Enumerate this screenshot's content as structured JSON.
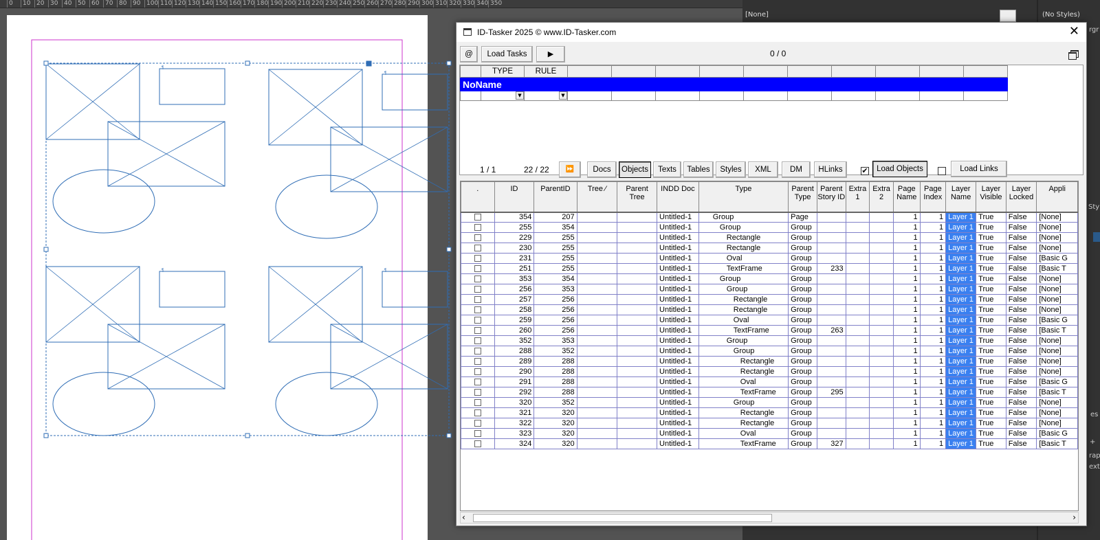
{
  "ruler": {
    "numbers": [
      "0",
      "10",
      "20",
      "30",
      "40",
      "50",
      "60",
      "70",
      "80",
      "90",
      "100",
      "110",
      "120",
      "130",
      "140",
      "150",
      "160",
      "170",
      "180",
      "190",
      "200",
      "210",
      "220",
      "230",
      "240",
      "250",
      "260",
      "270",
      "280",
      "290",
      "300",
      "310",
      "320",
      "330",
      "340",
      "350"
    ]
  },
  "right_panel": {
    "swatch_label": "[None]",
    "styles_label": "(No Styles)",
    "cut_labels": [
      "rgr",
      "Styl",
      "es",
      "+",
      "raph",
      "ext F"
    ]
  },
  "window": {
    "title": "ID-Tasker 2025  © www.ID-Tasker.com",
    "close_glyph": "✕",
    "toolbar": {
      "at_label": "@",
      "load_tasks_label": "Load Tasks",
      "play_glyph": "▶",
      "counter": "0 / 0"
    },
    "task_grid": {
      "headers": [
        "",
        "TYPE",
        "RULE",
        "",
        "",
        "",
        "",
        "",
        "",
        "",
        "",
        "",
        ""
      ],
      "group_name": "NoName"
    },
    "nav": {
      "pages": "1 / 1",
      "count": "22 / 22",
      "ffwd_glyph": "⏩",
      "tabs": [
        "Docs",
        "Objects",
        "Texts",
        "Tables",
        "Styles",
        "XML",
        "DM",
        "HLinks"
      ],
      "selected_tab": "Objects",
      "load_objects_checked": "✔",
      "load_objects_label": "Load Objects",
      "load_links_checked": "",
      "load_links_label": "Load Links"
    },
    "grid": {
      "columns": [
        ".",
        "ID",
        "ParentID",
        "Tree  ⁄",
        "Parent Tree",
        "INDD Doc",
        "Type",
        "Parent Type",
        "Parent Story ID",
        "Extra 1",
        "Extra 2",
        "Page Name",
        "Page Index",
        "Layer Name",
        "Layer Visible",
        "Layer Locked",
        "Appli"
      ],
      "rows": [
        {
          "id": "354",
          "parent": "207",
          "doc": "Untitled-1",
          "type": "Group",
          "indent": 2,
          "ptype": "Page",
          "story": "",
          "page": "1",
          "index": "1",
          "layer": "Layer 1",
          "vis": "True",
          "lock": "False",
          "appl": "[None]"
        },
        {
          "id": "255",
          "parent": "354",
          "doc": "Untitled-1",
          "type": "Group",
          "indent": 3,
          "ptype": "Group",
          "story": "",
          "page": "1",
          "index": "1",
          "layer": "Layer 1",
          "vis": "True",
          "lock": "False",
          "appl": "[None]"
        },
        {
          "id": "229",
          "parent": "255",
          "doc": "Untitled-1",
          "type": "Rectangle",
          "indent": 4,
          "ptype": "Group",
          "story": "",
          "page": "1",
          "index": "1",
          "layer": "Layer 1",
          "vis": "True",
          "lock": "False",
          "appl": "[None]"
        },
        {
          "id": "230",
          "parent": "255",
          "doc": "Untitled-1",
          "type": "Rectangle",
          "indent": 4,
          "ptype": "Group",
          "story": "",
          "page": "1",
          "index": "1",
          "layer": "Layer 1",
          "vis": "True",
          "lock": "False",
          "appl": "[None]"
        },
        {
          "id": "231",
          "parent": "255",
          "doc": "Untitled-1",
          "type": "Oval",
          "indent": 4,
          "ptype": "Group",
          "story": "",
          "page": "1",
          "index": "1",
          "layer": "Layer 1",
          "vis": "True",
          "lock": "False",
          "appl": "[Basic G"
        },
        {
          "id": "251",
          "parent": "255",
          "doc": "Untitled-1",
          "type": "TextFrame",
          "indent": 4,
          "ptype": "Group",
          "story": "233",
          "page": "1",
          "index": "1",
          "layer": "Layer 1",
          "vis": "True",
          "lock": "False",
          "appl": "[Basic T"
        },
        {
          "id": "353",
          "parent": "354",
          "doc": "Untitled-1",
          "type": "Group",
          "indent": 3,
          "ptype": "Group",
          "story": "",
          "page": "1",
          "index": "1",
          "layer": "Layer 1",
          "vis": "True",
          "lock": "False",
          "appl": "[None]"
        },
        {
          "id": "256",
          "parent": "353",
          "doc": "Untitled-1",
          "type": "Group",
          "indent": 4,
          "ptype": "Group",
          "story": "",
          "page": "1",
          "index": "1",
          "layer": "Layer 1",
          "vis": "True",
          "lock": "False",
          "appl": "[None]"
        },
        {
          "id": "257",
          "parent": "256",
          "doc": "Untitled-1",
          "type": "Rectangle",
          "indent": 5,
          "ptype": "Group",
          "story": "",
          "page": "1",
          "index": "1",
          "layer": "Layer 1",
          "vis": "True",
          "lock": "False",
          "appl": "[None]"
        },
        {
          "id": "258",
          "parent": "256",
          "doc": "Untitled-1",
          "type": "Rectangle",
          "indent": 5,
          "ptype": "Group",
          "story": "",
          "page": "1",
          "index": "1",
          "layer": "Layer 1",
          "vis": "True",
          "lock": "False",
          "appl": "[None]"
        },
        {
          "id": "259",
          "parent": "256",
          "doc": "Untitled-1",
          "type": "Oval",
          "indent": 5,
          "ptype": "Group",
          "story": "",
          "page": "1",
          "index": "1",
          "layer": "Layer 1",
          "vis": "True",
          "lock": "False",
          "appl": "[Basic G"
        },
        {
          "id": "260",
          "parent": "256",
          "doc": "Untitled-1",
          "type": "TextFrame",
          "indent": 5,
          "ptype": "Group",
          "story": "263",
          "page": "1",
          "index": "1",
          "layer": "Layer 1",
          "vis": "True",
          "lock": "False",
          "appl": "[Basic T"
        },
        {
          "id": "352",
          "parent": "353",
          "doc": "Untitled-1",
          "type": "Group",
          "indent": 4,
          "ptype": "Group",
          "story": "",
          "page": "1",
          "index": "1",
          "layer": "Layer 1",
          "vis": "True",
          "lock": "False",
          "appl": "[None]"
        },
        {
          "id": "288",
          "parent": "352",
          "doc": "Untitled-1",
          "type": "Group",
          "indent": 5,
          "ptype": "Group",
          "story": "",
          "page": "1",
          "index": "1",
          "layer": "Layer 1",
          "vis": "True",
          "lock": "False",
          "appl": "[None]"
        },
        {
          "id": "289",
          "parent": "288",
          "doc": "Untitled-1",
          "type": "Rectangle",
          "indent": 6,
          "ptype": "Group",
          "story": "",
          "page": "1",
          "index": "1",
          "layer": "Layer 1",
          "vis": "True",
          "lock": "False",
          "appl": "[None]"
        },
        {
          "id": "290",
          "parent": "288",
          "doc": "Untitled-1",
          "type": "Rectangle",
          "indent": 6,
          "ptype": "Group",
          "story": "",
          "page": "1",
          "index": "1",
          "layer": "Layer 1",
          "vis": "True",
          "lock": "False",
          "appl": "[None]"
        },
        {
          "id": "291",
          "parent": "288",
          "doc": "Untitled-1",
          "type": "Oval",
          "indent": 6,
          "ptype": "Group",
          "story": "",
          "page": "1",
          "index": "1",
          "layer": "Layer 1",
          "vis": "True",
          "lock": "False",
          "appl": "[Basic G"
        },
        {
          "id": "292",
          "parent": "288",
          "doc": "Untitled-1",
          "type": "TextFrame",
          "indent": 6,
          "ptype": "Group",
          "story": "295",
          "page": "1",
          "index": "1",
          "layer": "Layer 1",
          "vis": "True",
          "lock": "False",
          "appl": "[Basic T"
        },
        {
          "id": "320",
          "parent": "352",
          "doc": "Untitled-1",
          "type": "Group",
          "indent": 5,
          "ptype": "Group",
          "story": "",
          "page": "1",
          "index": "1",
          "layer": "Layer 1",
          "vis": "True",
          "lock": "False",
          "appl": "[None]"
        },
        {
          "id": "321",
          "parent": "320",
          "doc": "Untitled-1",
          "type": "Rectangle",
          "indent": 6,
          "ptype": "Group",
          "story": "",
          "page": "1",
          "index": "1",
          "layer": "Layer 1",
          "vis": "True",
          "lock": "False",
          "appl": "[None]"
        },
        {
          "id": "322",
          "parent": "320",
          "doc": "Untitled-1",
          "type": "Rectangle",
          "indent": 6,
          "ptype": "Group",
          "story": "",
          "page": "1",
          "index": "1",
          "layer": "Layer 1",
          "vis": "True",
          "lock": "False",
          "appl": "[None]"
        },
        {
          "id": "323",
          "parent": "320",
          "doc": "Untitled-1",
          "type": "Oval",
          "indent": 6,
          "ptype": "Group",
          "story": "",
          "page": "1",
          "index": "1",
          "layer": "Layer 1",
          "vis": "True",
          "lock": "False",
          "appl": "[Basic G"
        },
        {
          "id": "324",
          "parent": "320",
          "doc": "Untitled-1",
          "type": "TextFrame",
          "indent": 6,
          "ptype": "Group",
          "story": "327",
          "page": "1",
          "index": "1",
          "layer": "Layer 1",
          "vis": "True",
          "lock": "False",
          "appl": "[Basic T"
        }
      ]
    },
    "scroll": {
      "left_glyph": "‹",
      "right_glyph": "›"
    }
  },
  "colors": {
    "frame": "#2f6db5",
    "margin": "#cc33cc",
    "selection": "#2f6db5",
    "layer_highlight": "#3a80f0",
    "group_header": "#0000ff"
  }
}
